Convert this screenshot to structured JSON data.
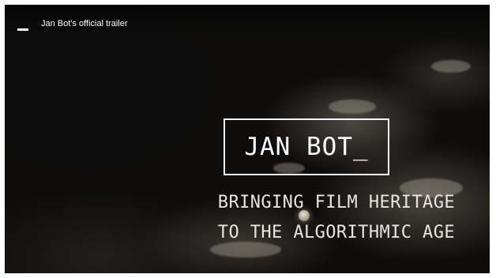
{
  "video": {
    "title": "Jan Bot's official trailer",
    "overlay_title": "JAN BOT_",
    "tagline_line1": "BRINGING FILM HERITAGE",
    "tagline_line2": "TO THE ALGORITHMIC AGE"
  },
  "icons": {
    "menu": "menu-icon"
  },
  "colors": {
    "background": "#0e0d0c",
    "text": "#ffffff",
    "frame": "#ffffff"
  }
}
